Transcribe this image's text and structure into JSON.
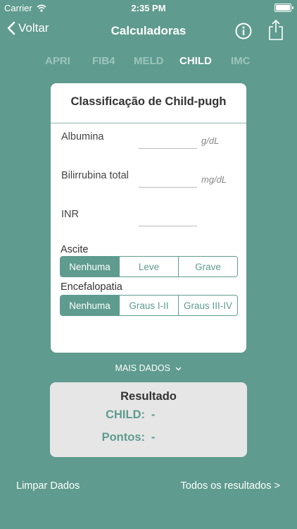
{
  "status_bar": {
    "carrier": "Carrier",
    "time": "2:35 PM"
  },
  "nav": {
    "back_label": "Voltar",
    "title": "Calculadoras"
  },
  "tabs": [
    {
      "label": "APRI",
      "active": false
    },
    {
      "label": "FIB4",
      "active": false
    },
    {
      "label": "MELD",
      "active": false
    },
    {
      "label": "CHILD",
      "active": true
    },
    {
      "label": "IMC",
      "active": false
    }
  ],
  "card": {
    "title": "Classificação de Child-pugh",
    "fields": [
      {
        "label": "Albumina",
        "value": "",
        "unit": "g/dL"
      },
      {
        "label": "Bilirrubina total",
        "value": "",
        "unit": "mg/dL"
      },
      {
        "label": "INR",
        "value": "",
        "unit": ""
      }
    ],
    "ascite": {
      "label": "Ascite",
      "options": [
        "Nenhuma",
        "Leve",
        "Grave"
      ],
      "selected": "Nenhuma"
    },
    "encefalopatia": {
      "label": "Encefalopatia",
      "options": [
        "Nenhuma",
        "Graus I-II",
        "Graus III-IV"
      ],
      "selected": "Nenhuma"
    }
  },
  "more_data": {
    "label": "MAIS DADOS"
  },
  "result": {
    "title": "Resultado",
    "child_label": "CHILD:",
    "child_value": "-",
    "points_label": "Pontos:",
    "points_value": "-"
  },
  "bottom": {
    "clear_label": "Limpar Dados",
    "all_results_label": "Todos os resultados >"
  },
  "colors": {
    "accent": "#5f9b8f",
    "tab_inactive": "#9cc5bc",
    "result_bg": "#e6e6e6"
  },
  "icons": [
    "wifi-icon",
    "battery-icon",
    "chevron-left-icon",
    "info-icon",
    "share-icon",
    "chevron-down-icon"
  ]
}
